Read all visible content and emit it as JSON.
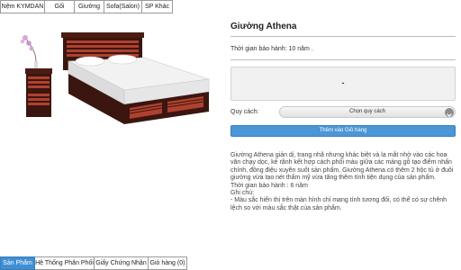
{
  "top_nav": {
    "tabs": [
      "Nệm KYMDAN",
      "Gối",
      "Giường",
      "Sofa(Salon)",
      "SP Khác"
    ]
  },
  "product": {
    "title": "Giường Athena",
    "warranty": "Thời gian bảo hành: 10 năm .",
    "price": "-",
    "option_label": "Quy cách:",
    "option_placeholder": "Chọn quy cách",
    "add_to_cart": "Thêm vào Giỏ hàng",
    "description": "Giường Athena giản dị, trang nhã nhưng khác biệt và lạ mắt nhờ vào các hoa văn chạy dọc, kẻ rãnh kết hợp cách phối màu giữa các mảng gỗ tạo điểm nhấn chính, đồng điệu xuyên suốt sản phẩm. Giường Athena có thêm 2 hộc tủ ở đuôi giường vừa tạo nét thẩm mỹ vừa tăng thêm tính tiện dụng của sản phẩm.",
    "warranty_line": "Thời gian bảo hành : 6 năm",
    "note_title": "Ghi chú:",
    "note_text": "- Màu sắc hiển thị trên màn hình chỉ mang tính tương đối, có thể có sự chênh lệch so với màu sắc thật của sản phẩm."
  },
  "bottom_nav": {
    "tabs": [
      "Sản Phẩm",
      "Hệ Thống Phân Phối",
      "Giấy Chứng Nhận",
      "Giỏ hàng (0)"
    ]
  },
  "colors": {
    "accent": "#3f8fd2",
    "button": "#4b96d6",
    "wood_dark": "#4a1c14",
    "wood_red": "#b0412e",
    "mattress": "#f2f2f2"
  },
  "icons": {
    "dropdown": "chevron-down-icon"
  }
}
